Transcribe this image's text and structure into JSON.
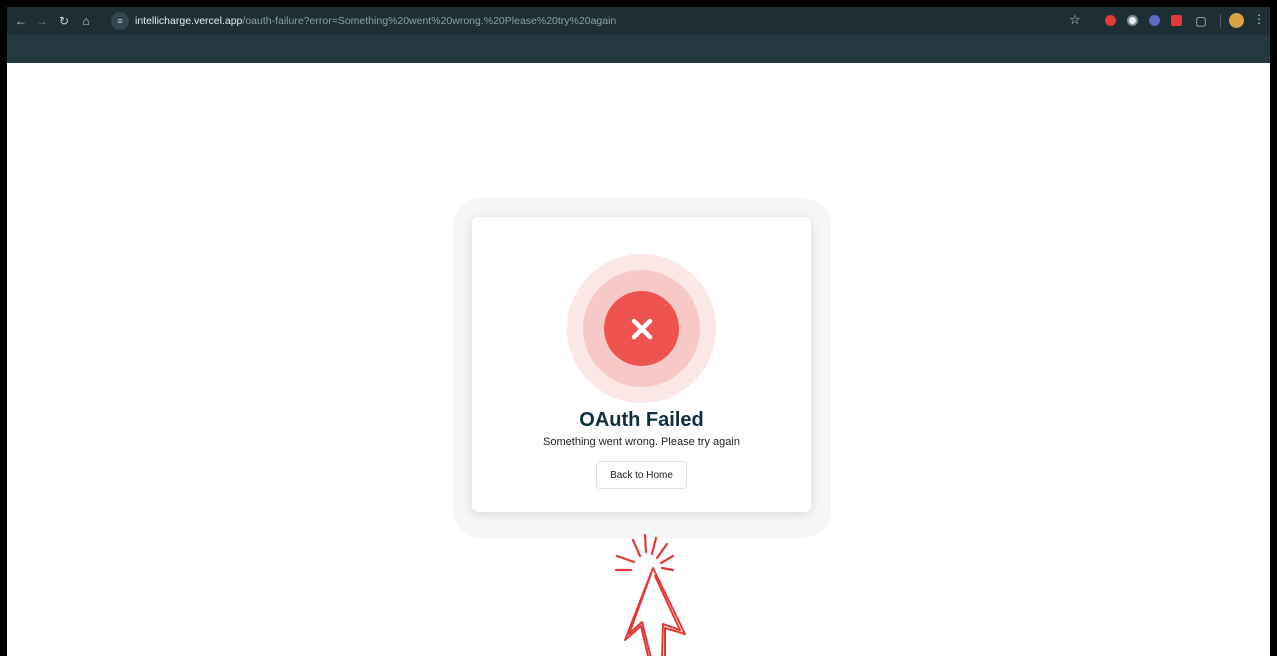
{
  "browser": {
    "url_host": "intellicharge.vercel.app",
    "url_path": "/oauth-failure?error=Something%20went%20wrong.%20Please%20try%20again",
    "icons": [
      "back-icon",
      "forward-icon",
      "reload-icon",
      "home-icon",
      "site-info-icon",
      "bookmark-star-icon",
      "extensions-icon",
      "menu-icon"
    ],
    "extension_colors": [
      "#e53935",
      "#e8eef0",
      "#5c6bc0",
      "#e53935"
    ]
  },
  "page": {
    "title": "OAuth Failed",
    "message": "Something went wrong. Please try again",
    "button_label": "Back to Home",
    "error_icon": "close-icon",
    "colors": {
      "error": "#ef5350",
      "title": "#0d2f3f",
      "annotation": "#e53935"
    }
  }
}
